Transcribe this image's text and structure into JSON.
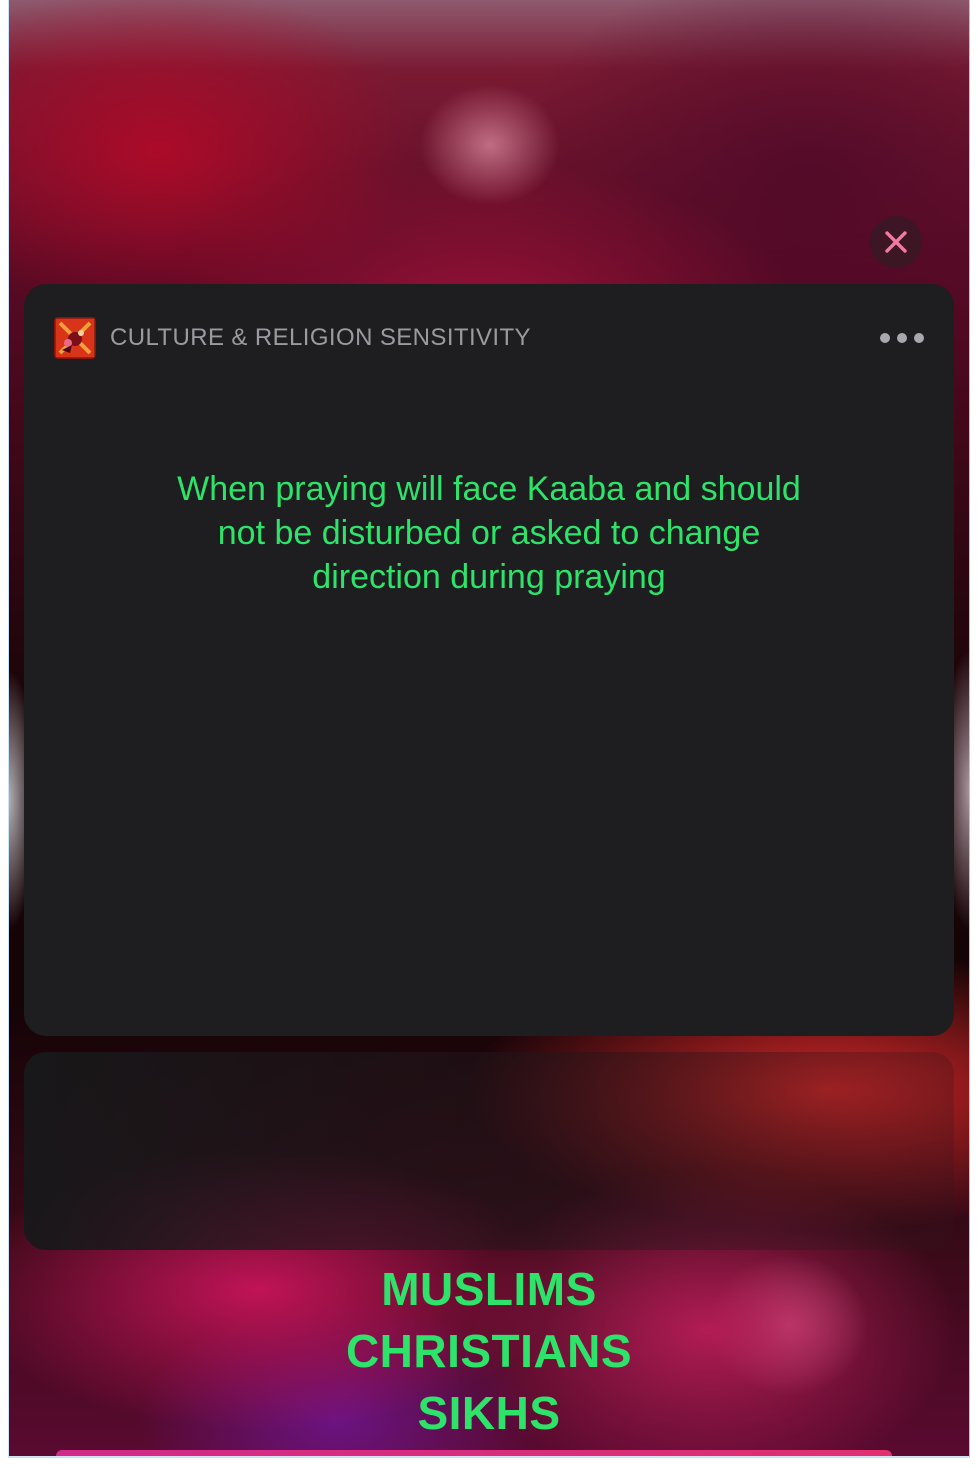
{
  "notification": {
    "app_name": "CULTURE & RELIGION SENSITIVITY",
    "message": "When praying will face Kaaba and should not be disturbed or asked to change direction during praying"
  },
  "groups": [
    "MUSLIMS",
    "CHRISTIANS",
    "SIKHS"
  ],
  "icons": {
    "close": "close-icon",
    "more": "more-options-icon",
    "app": "app-icon"
  },
  "colors": {
    "accent_text": "#2de36a",
    "card_background": "#1e1e20",
    "app_name_text": "#9a9aa0",
    "close_x": "#f07aa0"
  }
}
